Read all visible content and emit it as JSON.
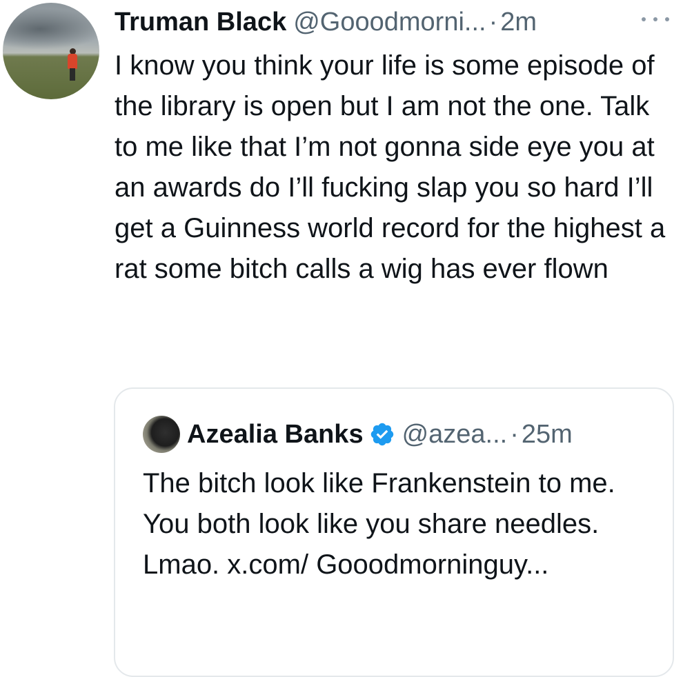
{
  "tweet": {
    "author_name": "Truman Black",
    "handle": "@Gooodmorni...",
    "separator": "·",
    "time": "2m",
    "text": "I know you think your life is some episode of the library is open but I am not the one. Talk to me like that I’m not gonna side eye you at an awards do I’ll fucking slap you so hard I’ll get a Guinness world record for the highest a rat some bitch calls a wig has ever flown"
  },
  "quote": {
    "author_name": "Azealia Banks",
    "verified": true,
    "handle": "@azea...",
    "separator": "·",
    "time": "25m",
    "text": "The bitch look like Frankenstein to me. You both look like you share needles. Lmao. x.com/ Gooodmorninguy..."
  },
  "icons": {
    "more": "more-horizontal-icon",
    "verified": "verified-badge-icon"
  },
  "colors": {
    "text": "#0f1419",
    "secondary": "#536471",
    "verified_blue": "#1d9bf0",
    "border": "#e4e8eb"
  }
}
